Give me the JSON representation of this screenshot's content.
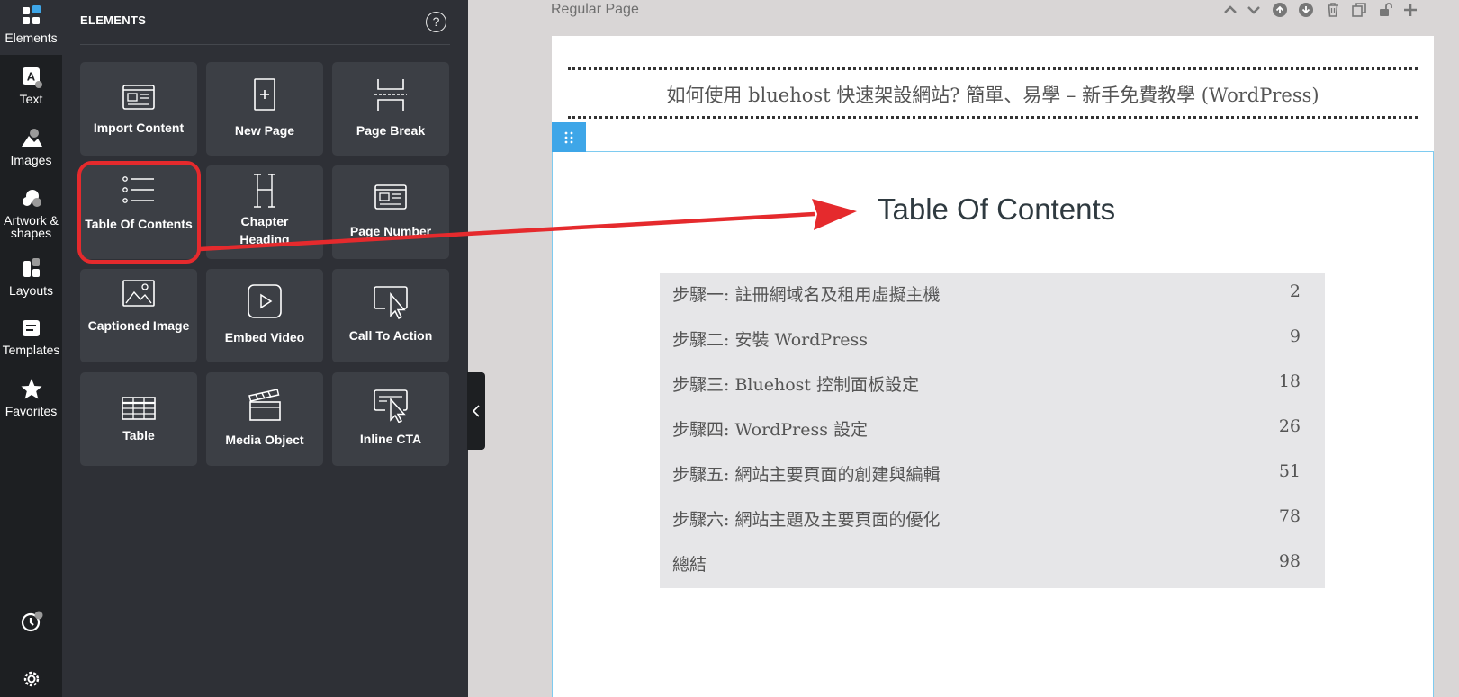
{
  "rail": {
    "items": [
      {
        "label": "Elements"
      },
      {
        "label": "Text"
      },
      {
        "label": "Images"
      },
      {
        "label": "Artwork &\nshapes"
      },
      {
        "label": "Layouts"
      },
      {
        "label": "Templates"
      },
      {
        "label": "Favorites"
      }
    ]
  },
  "panel": {
    "title": "ELEMENTS",
    "help_label": "?",
    "tiles": [
      {
        "label": "Import Content"
      },
      {
        "label": "New Page"
      },
      {
        "label": "Page Break"
      },
      {
        "label": "Table Of Contents"
      },
      {
        "label": "Chapter Heading"
      },
      {
        "label": "Page Number"
      },
      {
        "label": "Captioned Image"
      },
      {
        "label": "Embed Video"
      },
      {
        "label": "Call To Action"
      },
      {
        "label": "Table"
      },
      {
        "label": "Media Object"
      },
      {
        "label": "Inline CTA"
      }
    ]
  },
  "canvas": {
    "page_label": "Regular Page",
    "header_text": "如何使用 bluehost 快速架設網站? 簡單、易學 – 新手免費教學 (WordPress)",
    "toc_title": "Table Of Contents",
    "toc_entries": [
      {
        "name": "步驟一: 註冊網域名及租用虛擬主機",
        "page": "2"
      },
      {
        "name": "步驟二: 安裝 WordPress",
        "page": "9"
      },
      {
        "name": "步驟三: Bluehost 控制面板設定",
        "page": "18"
      },
      {
        "name": "步驟四: WordPress 設定",
        "page": "26"
      },
      {
        "name": "步驟五: 網站主要頁面的創建與編輯",
        "page": "51"
      },
      {
        "name": "步驟六: 網站主題及主要頁面的優化",
        "page": "78"
      },
      {
        "name": "總結",
        "page": "98"
      }
    ]
  },
  "colors": {
    "accent": "#3ea6e8",
    "highlight": "#e52a2d",
    "rail_bg": "#1d1f22",
    "panel_bg": "#2e3036",
    "tile_bg": "#3c3f45"
  }
}
